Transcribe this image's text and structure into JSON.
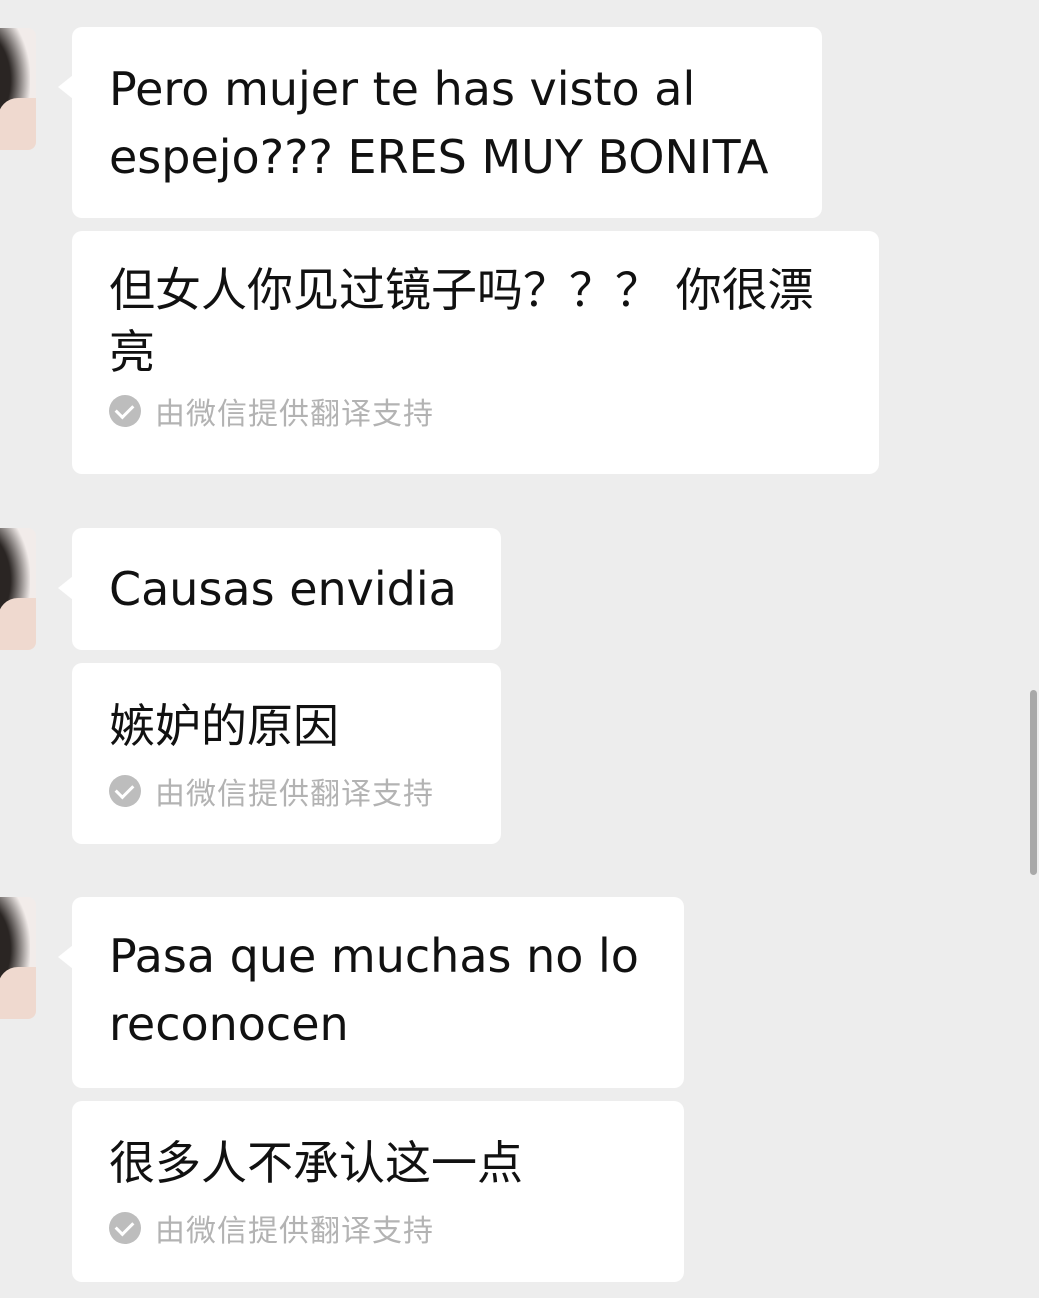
{
  "conversation": {
    "messages": [
      {
        "text": "Pero mujer te has visto al\nespejo??? ERES MUY BONITA",
        "translation": "但女人你见过镜子吗？？？ 你很漂\n亮",
        "translation_credit": "由微信提供翻译支持",
        "credit_icon": "check-circle-icon"
      },
      {
        "text": "Causas envidia",
        "translation": "嫉妒的原因",
        "translation_credit": "由微信提供翻译支持",
        "credit_icon": "check-circle-icon"
      },
      {
        "text": "Pasa que muchas no lo\nreconocen",
        "translation": "很多人不承认这一点",
        "translation_credit": "由微信提供翻译支持",
        "credit_icon": "check-circle-icon"
      }
    ]
  },
  "theme": {
    "background": "#ededed",
    "bubble": "#ffffff",
    "text": "#111111",
    "credit_text": "#b3b3b3",
    "check_icon": "#bdbdbd"
  }
}
